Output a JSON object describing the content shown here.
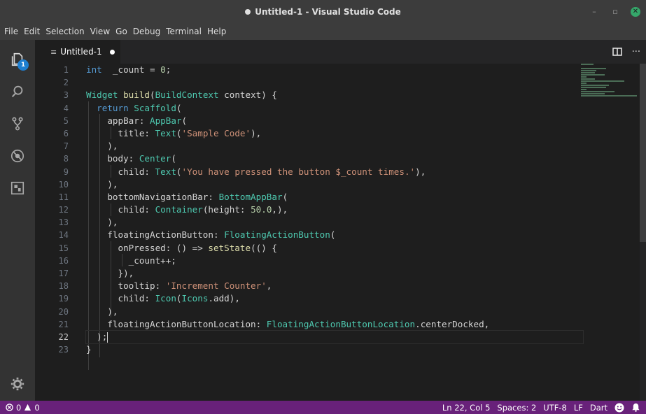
{
  "window": {
    "title": "Untitled-1 - Visual Studio Code"
  },
  "menu": [
    "File",
    "Edit",
    "Selection",
    "View",
    "Go",
    "Debug",
    "Terminal",
    "Help"
  ],
  "activity_bar": {
    "explorer_badge": "1"
  },
  "tabs": [
    {
      "label": "Untitled-1",
      "dirty": true
    }
  ],
  "editor": {
    "current_line": 22,
    "line_numbers": [
      "1",
      "2",
      "3",
      "4",
      "5",
      "6",
      "7",
      "8",
      "9",
      "10",
      "11",
      "12",
      "13",
      "14",
      "15",
      "16",
      "17",
      "18",
      "19",
      "20",
      "21",
      "22",
      "23"
    ],
    "lines": [
      [
        [
          "kw",
          "int"
        ],
        [
          "",
          "  _count = "
        ],
        [
          "nm",
          "0"
        ],
        [
          "",
          ";"
        ]
      ],
      [],
      [
        [
          "ty",
          "Widget"
        ],
        [
          "",
          ""
        ],
        [
          "fn",
          " build"
        ],
        [
          "",
          "("
        ],
        [
          "ty",
          "BuildContext"
        ],
        [
          "",
          " context) {"
        ]
      ],
      [
        [
          "",
          "  "
        ],
        [
          "kw",
          "return"
        ],
        [
          "",
          " "
        ],
        [
          "ty",
          "Scaffold"
        ],
        [
          "",
          "("
        ]
      ],
      [
        [
          "",
          "    appBar: "
        ],
        [
          "ty",
          "AppBar"
        ],
        [
          "",
          "("
        ]
      ],
      [
        [
          "",
          "      title: "
        ],
        [
          "ty",
          "Text"
        ],
        [
          "",
          "("
        ],
        [
          "st",
          "'Sample Code'"
        ],
        [
          "",
          "),"
        ]
      ],
      [
        [
          "",
          "    ),"
        ]
      ],
      [
        [
          "",
          "    body: "
        ],
        [
          "ty",
          "Center"
        ],
        [
          "",
          "("
        ]
      ],
      [
        [
          "",
          "      child: "
        ],
        [
          "ty",
          "Text"
        ],
        [
          "",
          "("
        ],
        [
          "st",
          "'You have pressed the button $_count times.'"
        ],
        [
          "",
          "),"
        ]
      ],
      [
        [
          "",
          "    ),"
        ]
      ],
      [
        [
          "",
          "    bottomNavigationBar: "
        ],
        [
          "ty",
          "BottomAppBar"
        ],
        [
          "",
          "("
        ]
      ],
      [
        [
          "",
          "      child: "
        ],
        [
          "ty",
          "Container"
        ],
        [
          "",
          "(height: "
        ],
        [
          "nm",
          "50.0"
        ],
        [
          "",
          ",),"
        ]
      ],
      [
        [
          "",
          "    ),"
        ]
      ],
      [
        [
          "",
          "    floatingActionButton: "
        ],
        [
          "ty",
          "FloatingActionButton"
        ],
        [
          "",
          "("
        ]
      ],
      [
        [
          "",
          "      onPressed: () => "
        ],
        [
          "fn",
          "setState"
        ],
        [
          "",
          "(() {"
        ]
      ],
      [
        [
          "",
          "        _count++;"
        ]
      ],
      [
        [
          "",
          "      }),"
        ]
      ],
      [
        [
          "",
          "      tooltip: "
        ],
        [
          "st",
          "'Increment Counter'"
        ],
        [
          "",
          ","
        ]
      ],
      [
        [
          "",
          "      child: "
        ],
        [
          "ty",
          "Icon"
        ],
        [
          "",
          "("
        ],
        [
          "ty",
          "Icons"
        ],
        [
          "",
          ".add),"
        ]
      ],
      [
        [
          "",
          "    ),"
        ]
      ],
      [
        [
          "",
          "    floatingActionButtonLocation: "
        ],
        [
          "ty",
          "FloatingActionButtonLocation"
        ],
        [
          "",
          ".centerDocked,"
        ]
      ],
      [
        [
          "",
          "  );"
        ]
      ],
      [
        [
          "",
          "}"
        ]
      ]
    ]
  },
  "status": {
    "errors": "0",
    "warnings": "0",
    "position": "Ln 22, Col 5",
    "spaces": "Spaces: 2",
    "encoding": "UTF-8",
    "eol": "LF",
    "language": "Dart"
  },
  "colors": {
    "status_bar": "#68217a",
    "keyword": "#569cd6",
    "type": "#4ec9b0",
    "function": "#dcdcaa",
    "string": "#ce9178",
    "number": "#b5cea8"
  }
}
